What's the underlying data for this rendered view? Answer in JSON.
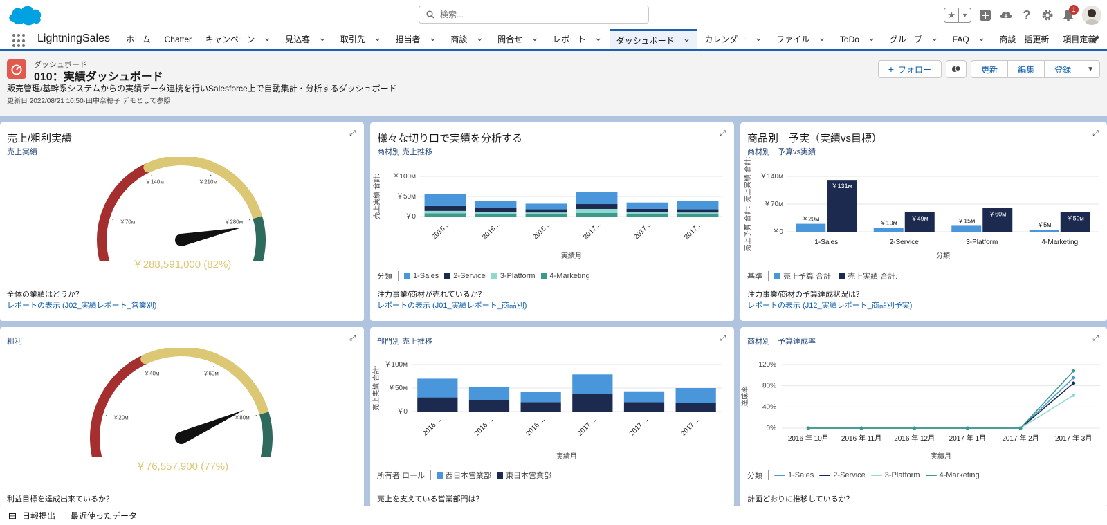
{
  "topbar": {
    "search_placeholder": "検索...",
    "notification_count": "1"
  },
  "nav": {
    "app_name": "LightningSales",
    "items": [
      {
        "label": "ホーム",
        "chevron": false
      },
      {
        "label": "Chatter",
        "chevron": false
      },
      {
        "label": "キャンペーン",
        "chevron": true
      },
      {
        "label": "見込客",
        "chevron": true
      },
      {
        "label": "取引先",
        "chevron": true
      },
      {
        "label": "担当者",
        "chevron": true
      },
      {
        "label": "商談",
        "chevron": true
      },
      {
        "label": "問合せ",
        "chevron": true
      },
      {
        "label": "レポート",
        "chevron": true
      },
      {
        "label": "ダッシュボード",
        "chevron": true,
        "active": true
      },
      {
        "label": "カレンダー",
        "chevron": true
      },
      {
        "label": "ファイル",
        "chevron": true
      },
      {
        "label": "ToDo",
        "chevron": true
      },
      {
        "label": "グループ",
        "chevron": true
      },
      {
        "label": "FAQ",
        "chevron": true
      },
      {
        "label": "商談一括更新",
        "chevron": false
      },
      {
        "label": "項目定義",
        "chevron": false
      },
      {
        "label": "見積",
        "chevron": true
      }
    ]
  },
  "header": {
    "object_label": "ダッシュボード",
    "title": "010：実績ダッシュボード",
    "description": "販売管理/基幹系システムからの実績データ連携を行いSalesforce上で自動集計・分析するダッシュボード",
    "meta": "更新日 2022/08/21 10:50·田中奈穂子 デモとして参照",
    "follow_label": "フォロー",
    "refresh_label": "更新",
    "edit_label": "編集",
    "subscribe_label": "登録"
  },
  "cards": {
    "c1": {
      "title": "売上/粗利実績",
      "subtitle": "売上実績",
      "question": "全体の業績はどうか？",
      "link": "レポートの表示 (J02_実績レポート_営業別)"
    },
    "c2": {
      "title": "様々な切り口で実績を分析する",
      "subtitle": "商材別 売上推移",
      "question": "注力事業/商材が売れているか？",
      "link": "レポートの表示 (J01_実績レポート_商品別)",
      "legend_label": "分類"
    },
    "c3": {
      "title": "商品別　予実（実績vs目標）",
      "subtitle": "商材別　予算vs実績",
      "question": "注力事業/商材の予算達成状況は？",
      "link": "レポートの表示 (J12_実績レポート_商品別予実)",
      "legend_label": "基準"
    },
    "c4": {
      "subtitle": "粗利",
      "question": "利益目標を達成出来ているか？"
    },
    "c5": {
      "subtitle": "部門別 売上推移",
      "question": "売上を支えている営業部門は？",
      "legend_label": "所有者 ロール"
    },
    "c6": {
      "subtitle": "商材別　予算達成率",
      "question": "計画どおりに推移しているか？",
      "legend_label": "分類"
    }
  },
  "footer": {
    "item1": "日報提出",
    "item2": "最近使ったデータ"
  },
  "chart_data": [
    {
      "type": "gauge",
      "subtitle": "売上実績",
      "value_label": "￥288,591,000 (82%)",
      "value_percent": 82,
      "tick_labels": [
        "￥0",
        "￥70м",
        "￥140м",
        "￥210м",
        "￥280м",
        "￥350м"
      ],
      "bands": [
        "#a52e2e",
        "#dcc874",
        "#2f6a5f"
      ]
    },
    {
      "type": "bar",
      "stacked": true,
      "subtitle": "商材別 売上推移",
      "xlabel": "実績月",
      "ylabel": "売上実績 合計:",
      "categories": [
        "2016...",
        "2016...",
        "2016...",
        "2017...",
        "2017...",
        "2017..."
      ],
      "y_ticks": [
        "￥0",
        "￥50м",
        "￥100м"
      ],
      "ylim": [
        0,
        100
      ],
      "series": [
        {
          "name": "4-Marketing",
          "color": "#3b9a8a",
          "values": [
            8,
            6,
            6,
            9,
            6,
            6
          ]
        },
        {
          "name": "3-Platform",
          "color": "#8fd8d2",
          "values": [
            6,
            6,
            4,
            10,
            6,
            4
          ]
        },
        {
          "name": "2-Service",
          "color": "#1b2a4e",
          "values": [
            12,
            10,
            8,
            12,
            7,
            8
          ]
        },
        {
          "name": "1-Sales",
          "color": "#4a96db",
          "values": [
            30,
            16,
            14,
            30,
            16,
            20
          ]
        }
      ]
    },
    {
      "type": "bar",
      "stacked": false,
      "subtitle": "商材別　予算vs実績",
      "xlabel": "分類",
      "ylabel": "売上予算 合計:, 売上実績 合計:",
      "categories": [
        "1-Sales",
        "2-Service",
        "3-Platform",
        "4-Marketing"
      ],
      "y_ticks": [
        "￥0",
        "￥70м",
        "￥140м"
      ],
      "ylim": [
        0,
        140
      ],
      "series": [
        {
          "name": "売上予算 合計:",
          "color": "#4a96db",
          "values": [
            20,
            10,
            15,
            5
          ],
          "labels": [
            "￥20м",
            "￥10м",
            "￥15м",
            "￥5м"
          ]
        },
        {
          "name": "売上実績 合計:",
          "color": "#1b2a4e",
          "values": [
            131,
            49,
            60,
            50
          ],
          "labels": [
            "￥131м",
            "￥49м",
            "￥60м",
            "￥50м"
          ]
        }
      ]
    },
    {
      "type": "gauge",
      "subtitle": "粗利",
      "value_label": "￥76,557,900 (77%)",
      "value_percent": 77,
      "tick_labels": [
        "￥0",
        "￥20м",
        "￥40м",
        "￥60м",
        "￥80м",
        "￥100м"
      ],
      "bands": [
        "#a52e2e",
        "#dcc874",
        "#2f6a5f"
      ]
    },
    {
      "type": "bar",
      "stacked": true,
      "subtitle": "部門別 売上推移",
      "xlabel": "実績月",
      "ylabel": "売上実績 合計:",
      "categories": [
        "2016 ...",
        "2016 ...",
        "2016 ...",
        "2017 ...",
        "2017 ...",
        "2017 ..."
      ],
      "y_ticks": [
        "￥0",
        "￥50м",
        "￥100м"
      ],
      "ylim": [
        0,
        100
      ],
      "series": [
        {
          "name": "東日本営業部",
          "color": "#1b2a4e",
          "values": [
            30,
            24,
            20,
            37,
            20,
            19
          ]
        },
        {
          "name": "西日本営業部",
          "color": "#4a96db",
          "values": [
            40,
            29,
            22,
            42,
            23,
            31
          ]
        }
      ]
    },
    {
      "type": "line",
      "subtitle": "商材別　予算達成率",
      "xlabel": "実績月",
      "ylabel": "達成率",
      "categories": [
        "2016 年 10月",
        "2016 年 11月",
        "2016 年 12月",
        "2017 年 1月",
        "2017 年 2月",
        "2017 年 3月"
      ],
      "y_ticks": [
        "0%",
        "40%",
        "80%",
        "120%"
      ],
      "ylim": [
        0,
        120
      ],
      "series": [
        {
          "name": "1-Sales",
          "color": "#4a96db",
          "values": [
            0,
            0,
            0,
            0,
            0,
            95
          ]
        },
        {
          "name": "2-Service",
          "color": "#1b2a4e",
          "values": [
            0,
            0,
            0,
            0,
            0,
            85
          ]
        },
        {
          "name": "3-Platform",
          "color": "#8fd8d2",
          "values": [
            0,
            0,
            0,
            0,
            0,
            62
          ]
        },
        {
          "name": "4-Marketing",
          "color": "#3b9a8a",
          "values": [
            0,
            0,
            0,
            0,
            0,
            108
          ]
        }
      ]
    }
  ]
}
